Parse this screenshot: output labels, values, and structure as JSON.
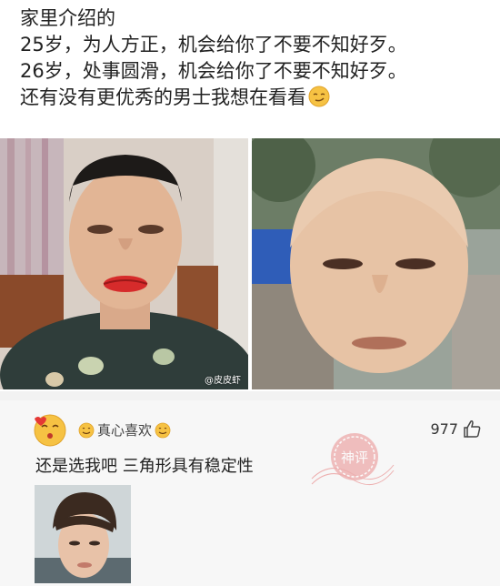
{
  "post": {
    "lines": [
      "家里介绍的",
      "25岁，为人方正，机会给你了不要不知好歹。",
      "26岁，处事圆滑，机会给你了不要不知好歹。",
      "还有没有更优秀的男士我想在看看"
    ],
    "trailing_emoji": "smirk-emoji"
  },
  "photos": {
    "left_watermark": "@皮皮虾"
  },
  "comment": {
    "username": "真心喜欢",
    "like_count": "977",
    "text": "还是选我吧 三角形具有稳定性",
    "stamp_text": "神评"
  },
  "colors": {
    "divider": "#f2f2f2",
    "comment_bg": "#f7f7f7",
    "stamp": "#e57373"
  }
}
